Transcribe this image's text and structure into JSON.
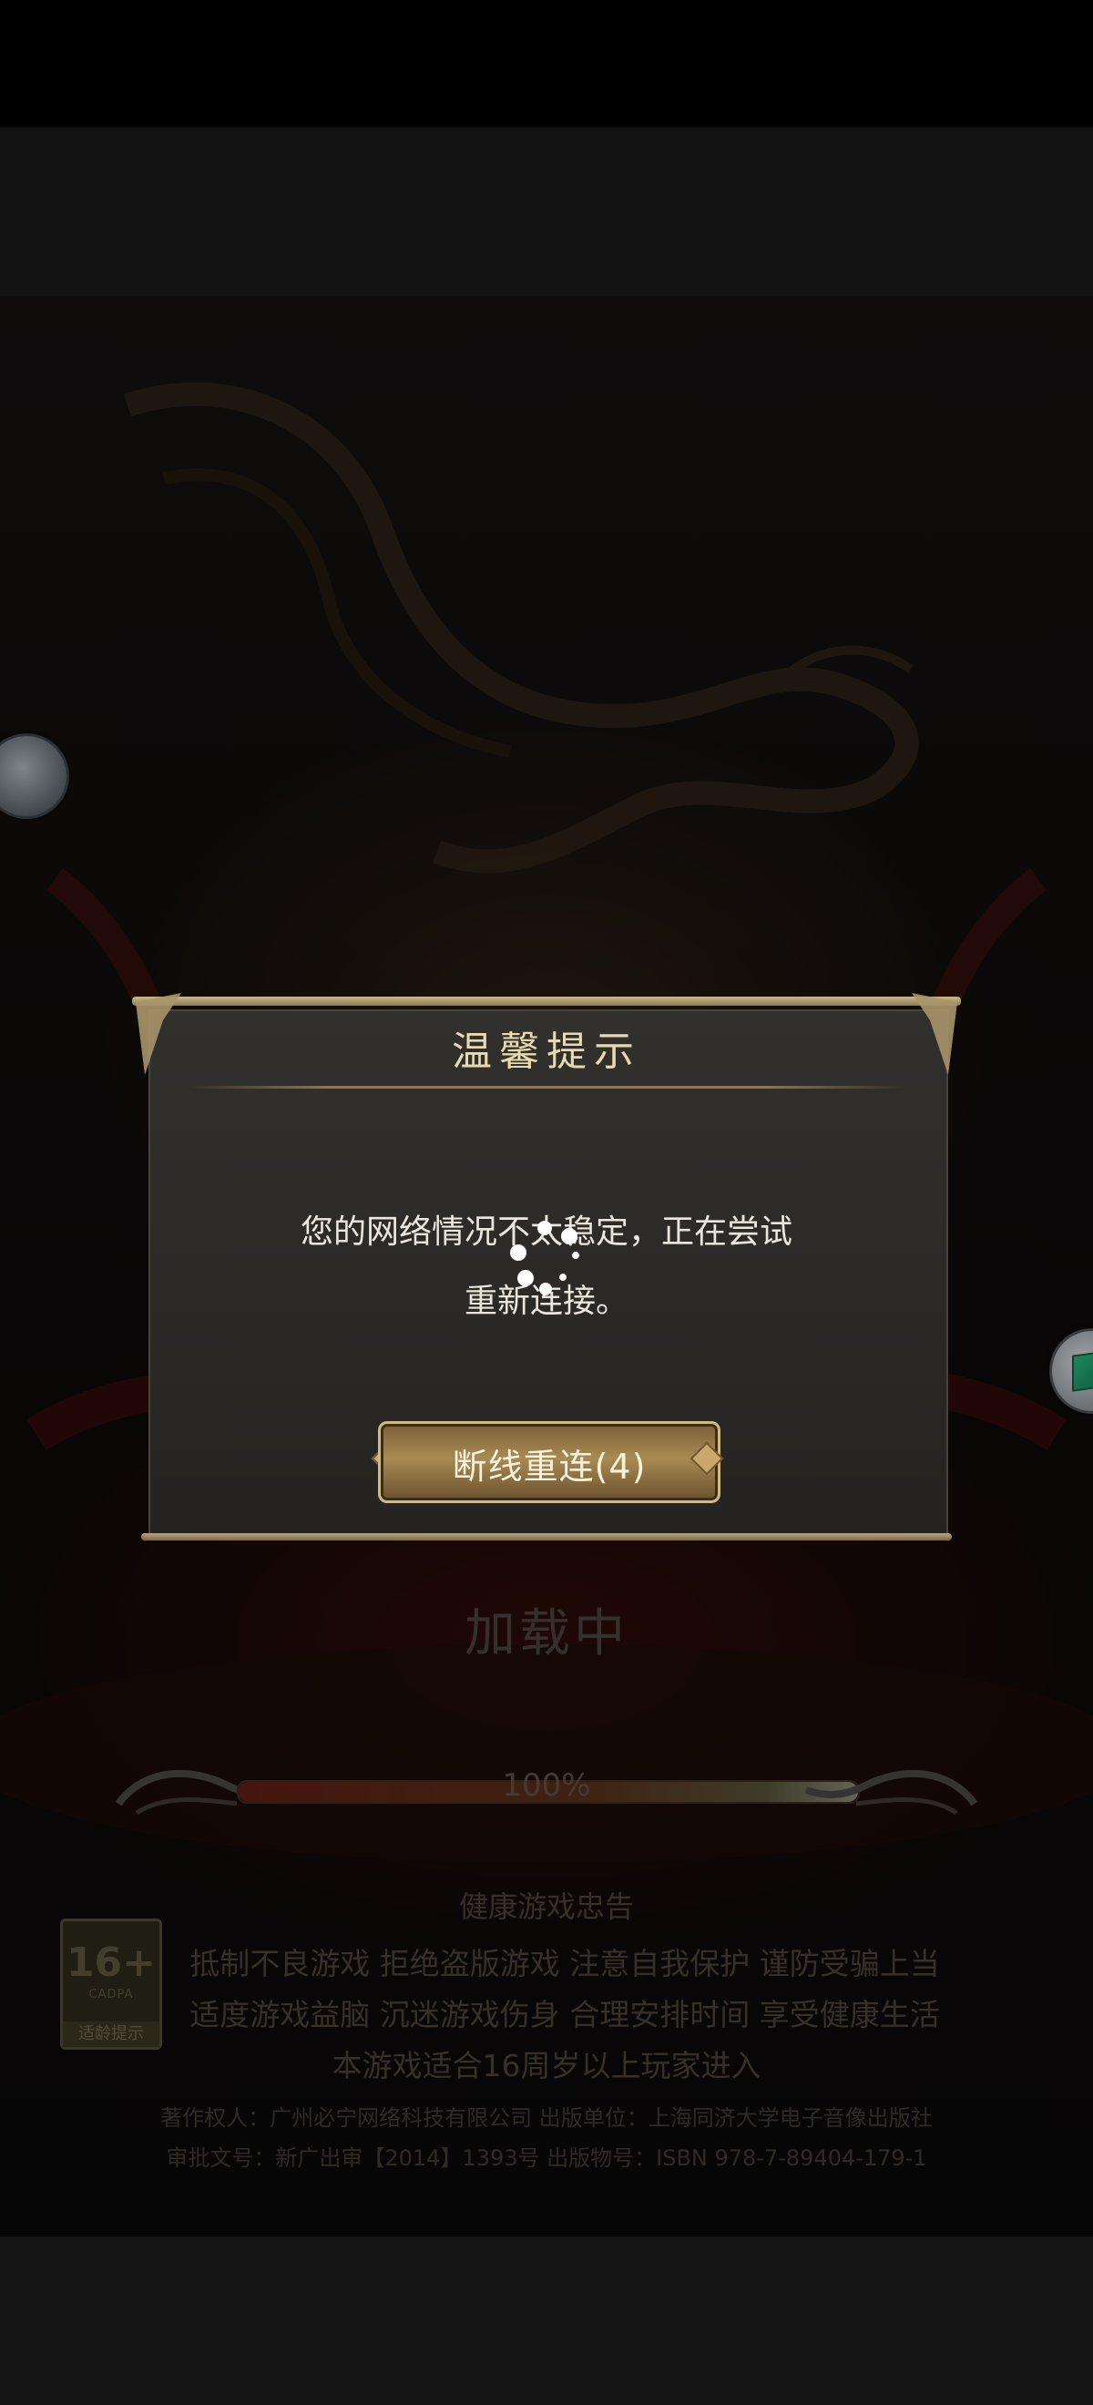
{
  "dialog": {
    "title": "温馨提示",
    "message_line1": "您的网络情况不太稳定，正在尝试",
    "message_line2": "重新连接。",
    "reconnect_button": "断线重连(4)"
  },
  "loading": {
    "label": "加载中",
    "progress_text": "100%",
    "progress": 1.0
  },
  "health_advice": {
    "title": "健康游戏忠告",
    "line1": "抵制不良游戏  拒绝盗版游戏  注意自我保护  谨防受骗上当",
    "line2": "适度游戏益脑  沉迷游戏伤身  合理安排时间  享受健康生活",
    "line3": "本游戏适合16周岁以上玩家进入"
  },
  "age_rating": {
    "number": "16+",
    "org": "CADPA",
    "tip": "适龄提示"
  },
  "copyright": {
    "line1": "著作权人：广州必宁网络科技有限公司 出版单位：上海同济大学电子音像出版社",
    "line2": "审批文号：新广出审【2014】1393号 出版物号：ISBN 978-7-89404-179-1"
  },
  "icons": {
    "left_floating": "floating-assistant-icon",
    "right_floating": "cube-tool-icon"
  }
}
